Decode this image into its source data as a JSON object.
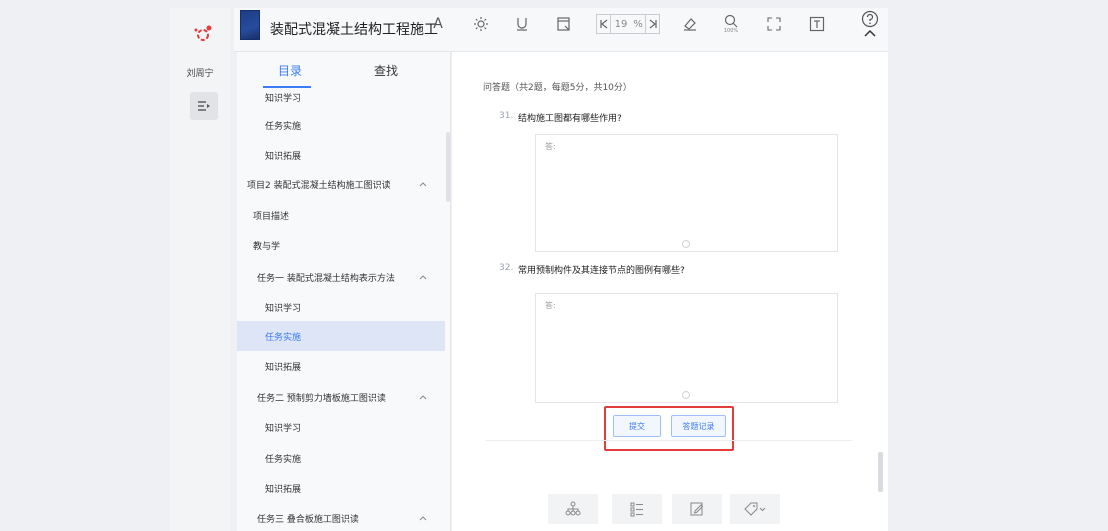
{
  "app": {
    "book_title": "装配式混凝土结构工程施工",
    "user_name": "刘周宁"
  },
  "toolbar": {
    "font_label": "A",
    "page_current": "19",
    "page_percent": "%",
    "zoom_label": "100%",
    "icons": [
      "font-icon",
      "brightness-icon",
      "underline-icon",
      "note-icon",
      "page-first-icon",
      "page-last-icon",
      "eraser-icon",
      "zoom-icon",
      "fullscreen-icon",
      "text-icon",
      "help-icon",
      "chevron-up-icon"
    ]
  },
  "sidebar": {
    "tabs": [
      {
        "label": "目录",
        "active": true
      },
      {
        "label": "查找",
        "active": false
      }
    ],
    "items": [
      {
        "label": "知识学习",
        "indent": 1
      },
      {
        "label": "任务实施",
        "indent": 1
      },
      {
        "label": "知识拓展",
        "indent": 1
      },
      {
        "label": "项目2 装配式混凝土结构施工图识读",
        "indent": 0,
        "expandable": true
      },
      {
        "label": "项目描述",
        "indent": 0
      },
      {
        "label": "教与学",
        "indent": 0
      },
      {
        "label": "任务一 装配式混凝土结构表示方法",
        "indent": 1,
        "expandable": true
      },
      {
        "label": "知识学习",
        "indent": 1
      },
      {
        "label": "任务实施",
        "indent": 1,
        "selected": true
      },
      {
        "label": "知识拓展",
        "indent": 1
      },
      {
        "label": "任务二 预制剪力墙板施工图识读",
        "indent": 1,
        "expandable": true
      },
      {
        "label": "知识学习",
        "indent": 1
      },
      {
        "label": "任务实施",
        "indent": 1
      },
      {
        "label": "知识拓展",
        "indent": 1
      },
      {
        "label": "任务三 叠合板施工图识读",
        "indent": 1,
        "expandable": true
      }
    ]
  },
  "content": {
    "section_title": "问答题（共2题，每题5分，共10分）",
    "questions": [
      {
        "number": "31.",
        "text": "结构施工图都有哪些作用?",
        "answer_label": "答:"
      },
      {
        "number": "32.",
        "text": "常用预制构件及其连接节点的图例有哪些?",
        "answer_label": "答:"
      }
    ],
    "submit_label": "提交",
    "history_label": "答题记录"
  },
  "bottom_bar": {
    "icons": [
      "hierarchy-icon",
      "list-icon",
      "edit-icon",
      "tag-icon"
    ]
  },
  "colors": {
    "accent": "#3d7bf4",
    "highlight": "#e43b3b",
    "selected_bg": "#dde5f6"
  }
}
